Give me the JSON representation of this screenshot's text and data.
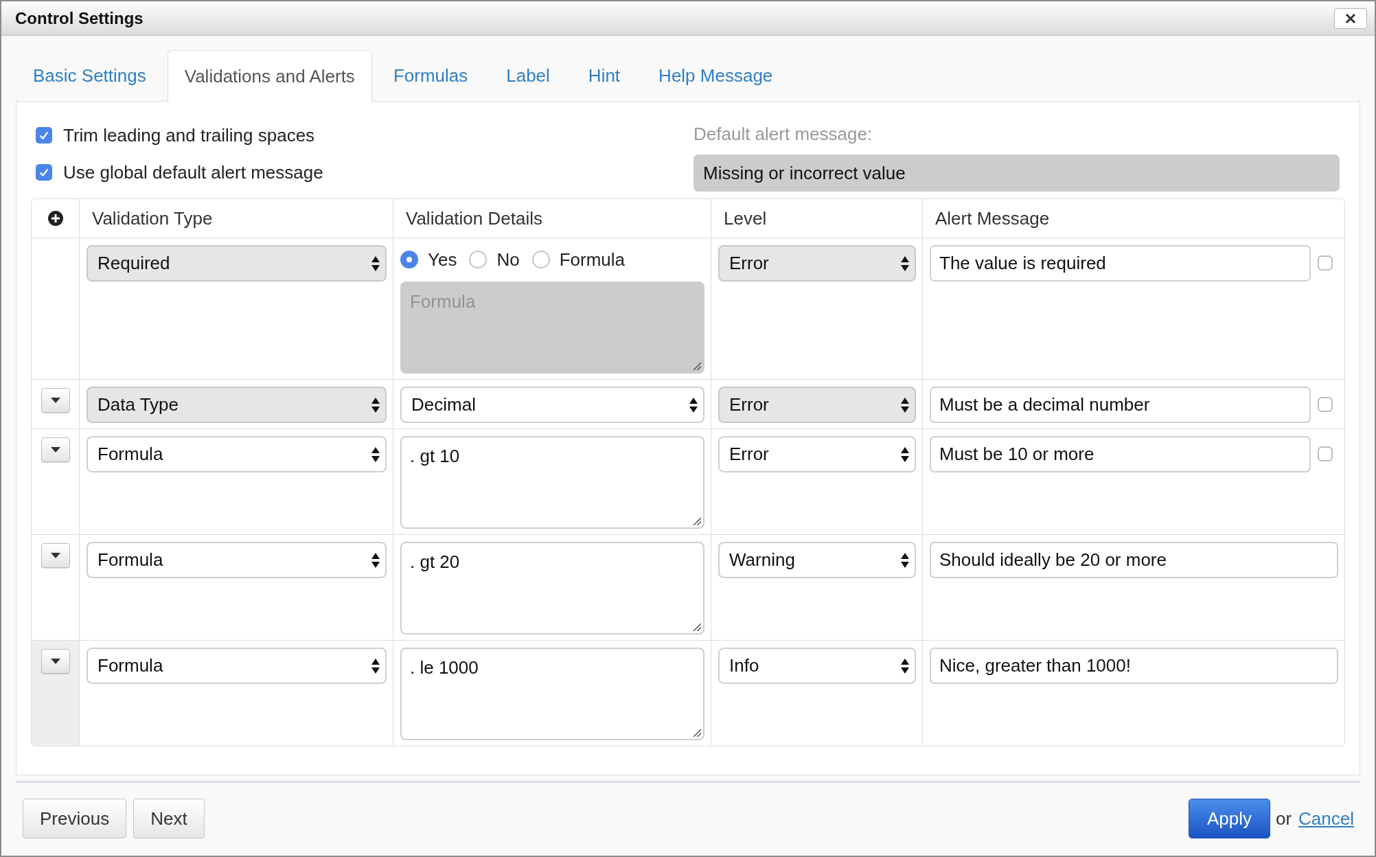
{
  "window": {
    "title": "Control Settings"
  },
  "tabs": [
    {
      "label": "Basic Settings",
      "selected": false
    },
    {
      "label": "Validations and Alerts",
      "selected": true
    },
    {
      "label": "Formulas",
      "selected": false
    },
    {
      "label": "Label",
      "selected": false
    },
    {
      "label": "Hint",
      "selected": false
    },
    {
      "label": "Help Message",
      "selected": false
    }
  ],
  "options": [
    {
      "label": "Trim leading and trailing spaces",
      "checked": true
    },
    {
      "label": "Use global default alert message",
      "checked": true
    }
  ],
  "default_alert": {
    "label": "Default alert message:",
    "value": "Missing or incorrect value",
    "disabled": true
  },
  "table": {
    "columns": [
      "Validation Type",
      "Validation Details",
      "Level",
      "Alert Message"
    ],
    "rows": [
      {
        "highlighted": false,
        "row_menu": false,
        "type": {
          "value": "Required",
          "disabled": true
        },
        "details": {
          "kind": "radio",
          "options": [
            {
              "label": "Yes",
              "selected": true
            },
            {
              "label": "No",
              "selected": false
            },
            {
              "label": "Formula",
              "selected": false
            }
          ],
          "formula": {
            "placeholder": "Formula",
            "disabled": true
          }
        },
        "level": {
          "value": "Error",
          "disabled": true
        },
        "alert": "The value is required",
        "alert_check": {
          "checked": false
        }
      },
      {
        "highlighted": false,
        "row_menu": true,
        "type": {
          "value": "Data Type",
          "disabled": true
        },
        "details": {
          "kind": "select",
          "value": "Decimal",
          "disabled": false
        },
        "level": {
          "value": "Error",
          "disabled": true
        },
        "alert": "Must be a decimal number",
        "alert_check": {
          "checked": false
        }
      },
      {
        "highlighted": false,
        "row_menu": true,
        "type": {
          "value": "Formula",
          "disabled": false
        },
        "details": {
          "kind": "formula",
          "value": ". gt 10"
        },
        "level": {
          "value": "Error",
          "disabled": false
        },
        "alert": "Must be 10 or more",
        "alert_check": {
          "checked": false
        }
      },
      {
        "highlighted": false,
        "row_menu": true,
        "type": {
          "value": "Formula",
          "disabled": false
        },
        "details": {
          "kind": "formula",
          "value": ". gt 20"
        },
        "level": {
          "value": "Warning",
          "disabled": false
        },
        "alert": "Should ideally be 20 or more"
      },
      {
        "highlighted": true,
        "row_menu": true,
        "type": {
          "value": "Formula",
          "disabled": false
        },
        "details": {
          "kind": "formula",
          "value": ". le 1000"
        },
        "level": {
          "value": "Info",
          "disabled": false
        },
        "alert": "Nice, greater than 1000!"
      }
    ]
  },
  "footer": {
    "nav_buttons": [
      "Previous",
      "Next"
    ],
    "apply": "Apply",
    "or": "or",
    "cancel": "Cancel"
  }
}
